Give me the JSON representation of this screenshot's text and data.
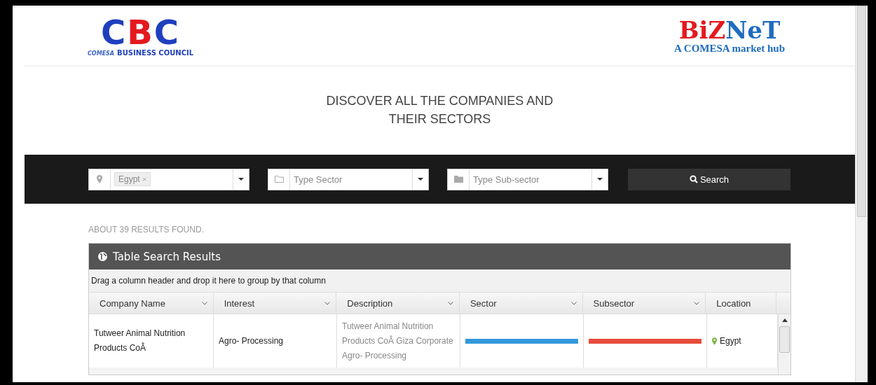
{
  "header": {
    "left_logo": {
      "letters": [
        "C",
        "B",
        "C"
      ],
      "badge": "COMESA",
      "tagline": "BUSINESS COUNCIL"
    },
    "right_logo": {
      "name_red": "BiZ",
      "name_blue": "NeT",
      "tagline": "A COMESA market hub"
    }
  },
  "heading": "DISCOVER ALL THE COMPANIES AND THEIR SECTORS",
  "filters": [
    {
      "kind": "country",
      "tag": "Egypt",
      "tag_remove": "×"
    },
    {
      "kind": "sector",
      "placeholder": "Type Sector"
    },
    {
      "kind": "subsector",
      "placeholder": "Type Sub-sector"
    }
  ],
  "search_button": "Search",
  "results_count": "ABOUT 39 RESULTS FOUND.",
  "table": {
    "title": "Table Search Results",
    "group_hint": "Drag a column header and drop it here to group by that column",
    "columns": [
      {
        "label": "Company Name",
        "menu": true
      },
      {
        "label": "Interest",
        "menu": true
      },
      {
        "label": "Description",
        "menu": true
      },
      {
        "label": "Sector",
        "menu": true
      },
      {
        "label": "Subsector",
        "menu": true
      },
      {
        "label": "Location",
        "menu": false
      }
    ],
    "rows": [
      {
        "company": "Tutweer Animal Nutrition Products CoÂ",
        "interest": "Agro- Processing",
        "description": "Tutweer Animal Nutrition Products CoÂ  Giza Corporate Agro- Processing",
        "sector": {
          "color": "#3498db"
        },
        "subsector": {
          "color": "#e74c3c"
        },
        "location": "Egypt"
      }
    ]
  }
}
